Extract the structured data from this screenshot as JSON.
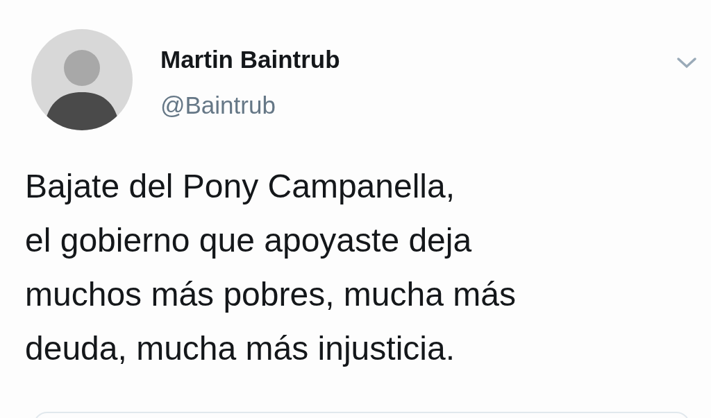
{
  "tweet": {
    "author": {
      "name": "Martin Baintrub",
      "handle": "@Baintrub"
    },
    "lines": [
      "Bajate del Pony Campanella,",
      "el gobierno que apoyaste deja",
      "muchos más pobres, mucha más",
      "deuda, mucha más injusticia."
    ]
  }
}
